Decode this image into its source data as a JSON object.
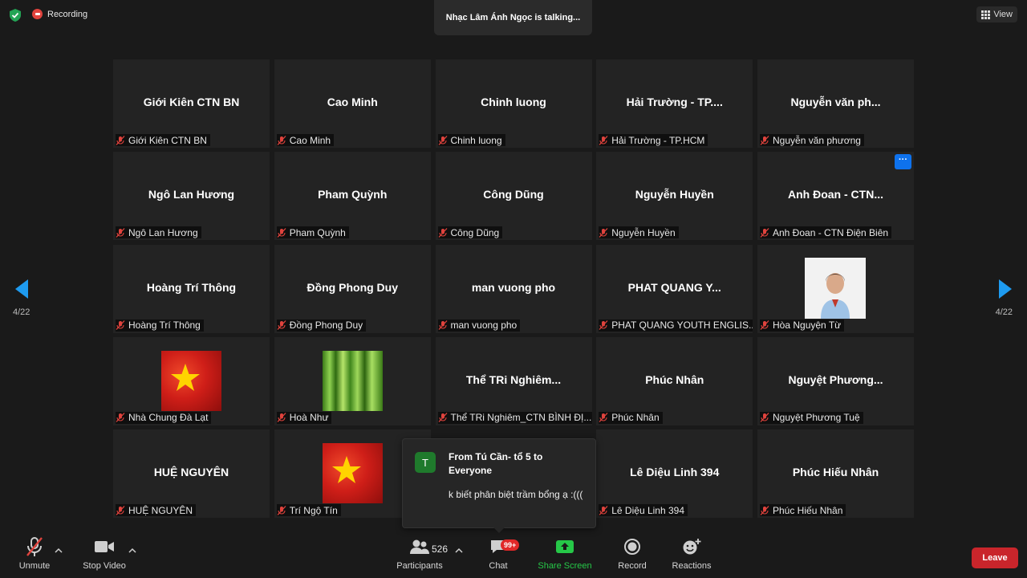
{
  "topbar": {
    "recording_label": "Recording",
    "talking_text": "Nhạc Lâm Ánh Ngọc is talking...",
    "view_label": "View"
  },
  "pagination": {
    "left": "4/22",
    "right": "4/22"
  },
  "tiles": [
    {
      "big": "Giới Kiên CTN BN",
      "label": "Giới Kiên CTN BN"
    },
    {
      "big": "Cao Minh",
      "label": "Cao Minh"
    },
    {
      "big": "Chinh luong",
      "label": "Chinh luong"
    },
    {
      "big": "Hải Trường - TP....",
      "label": "Hải Trường - TP.HCM"
    },
    {
      "big": "Nguyễn văn ph...",
      "label": "Nguyễn văn phương"
    },
    {
      "big": "Ngô Lan Hương",
      "label": "Ngô Lan Hương"
    },
    {
      "big": "Pham Quỳnh",
      "label": "Pham Quỳnh"
    },
    {
      "big": "Công Dũng",
      "label": "Công Dũng"
    },
    {
      "big": "Nguyễn Huyền",
      "label": "Nguyễn Huyền"
    },
    {
      "big": "Anh Đoan - CTN...",
      "label": "Anh Đoan - CTN Điện Biên",
      "more": "···"
    },
    {
      "big": "Hoàng Trí Thông",
      "label": "Hoàng Trí Thông"
    },
    {
      "big": "Đồng Phong Duy",
      "label": "Đồng Phong Duy"
    },
    {
      "big": "man vuong pho",
      "label": "man vuong pho"
    },
    {
      "big": "PHAT QUANG Y...",
      "label": "PHAT QUANG YOUTH ENGLIS..."
    },
    {
      "big": "",
      "label": "Hòa Nguyện Từ",
      "pic": "photo"
    },
    {
      "big": "",
      "label": "Nhà Chung Đà Lạt",
      "pic": "flag"
    },
    {
      "big": "",
      "label": "Hoà Như",
      "pic": "forest"
    },
    {
      "big": "Thể TRi Nghiêm...",
      "label": "Thể TRi Nghiêm_CTN BÌNH ĐỊ..."
    },
    {
      "big": "Phúc Nhân",
      "label": "Phúc Nhân"
    },
    {
      "big": "Nguyệt  Phương...",
      "label": "Nguyệt Phương Tuệ"
    },
    {
      "big": "HUỆ NGUYÊN",
      "label": "HUỆ NGUYÊN"
    },
    {
      "big": "",
      "label": "Trí Ngộ Tín",
      "pic": "flag"
    },
    {
      "big": "",
      "label": ""
    },
    {
      "big": "Lê Diệu Linh 394",
      "label": "Lê Diệu Linh 394"
    },
    {
      "big": "Phúc Hiếu Nhân",
      "label": "Phúc Hiếu Nhân"
    }
  ],
  "chat_popup": {
    "avatar_letter": "T",
    "from": "From Tú Cần- tổ 5 to Everyone",
    "message": "k biết phân biệt trầm bổng ạ :((("
  },
  "toolbar": {
    "unmute": "Unmute",
    "stop_video": "Stop Video",
    "participants": "Participants",
    "participants_count": "526",
    "chat": "Chat",
    "chat_badge": "99+",
    "share_screen": "Share Screen",
    "record": "Record",
    "reactions": "Reactions",
    "leave": "Leave"
  },
  "colors": {
    "background": "#1a1a1a",
    "tile": "#232323",
    "accent_blue": "#0e72ed",
    "share_green": "#26c848",
    "leave_red": "#c9252b",
    "mute_red": "#e0433d"
  },
  "icons": [
    "shield-icon",
    "record-icon",
    "grid-icon",
    "muted-mic-icon",
    "left-arrow-icon",
    "right-arrow-icon",
    "video-icon",
    "participants-icon",
    "chat-icon",
    "share-screen-icon",
    "record-button-icon",
    "reactions-icon",
    "caret-up-icon"
  ]
}
